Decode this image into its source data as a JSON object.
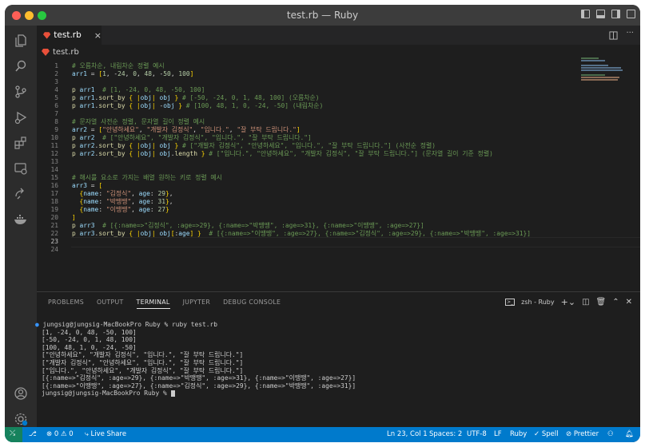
{
  "window": {
    "title": "test.rb — Ruby",
    "traffic_lights": {
      "close": "#ff5f57",
      "minimize": "#febc2e",
      "zoom": "#28c840"
    }
  },
  "tab": {
    "label": "test.rb",
    "close": "×"
  },
  "breadcrumb": {
    "file": "test.rb"
  },
  "editor": {
    "line_numbers": [
      "1",
      "2",
      "3",
      "4",
      "5",
      "6",
      "7",
      "8",
      "9",
      "10",
      "11",
      "12",
      "13",
      "14",
      "15",
      "16",
      "17",
      "18",
      "19",
      "20",
      "21",
      "22",
      "23",
      "24"
    ],
    "lines": [
      "# 오름차순, 내림차순 정렬 예시",
      "arr1 = [1, -24, 0, 48, -50, 100]",
      "",
      "p arr1  # [1, -24, 0, 48, -50, 100]",
      "p arr1.sort_by { |obj| obj } # [-50, -24, 0, 1, 48, 100] (오름차순)",
      "p arr1.sort_by { |obj| -obj } # [100, 48, 1, 0, -24, -50] (내림차순)",
      "",
      "# 문자열 사전순 정렬, 문자열 길이 정렬 예시",
      "arr2 = [\"안녕하세요\", \"개발자 김정식\", \"입니다.\", \"잘 부탁 드립니다.\"]",
      "p arr2  # [\"안녕하세요\", \"개발자 김정식\", \"입니다.\", \"잘 부탁 드립니다.\"]",
      "p arr2.sort_by { |obj| obj } # [\"개발자 김정식\", \"안녕하세요\", \"입니다.\", \"잘 부탁 드립니다.\"] (사전순 정렬)",
      "p arr2.sort_by { |obj| obj.length } # [\"입니다.\", \"안녕하세요\", \"개발자 김정식\", \"잘 부탁 드립니다.\"] (문자열 길이 기준 정렬)",
      "",
      "",
      "# 해시를 요소로 가지는 배열 원하는 키로 정렬 예시",
      "arr3 = [",
      "  {name: \"김정식\", age: 29},",
      "  {name: \"박땡땡\", age: 31},",
      "  {name: \"이땡땡\", age: 27}",
      "]",
      "p arr3  # [{:name=>\"김정식\", :age=>29}, {:name=>\"박땡땡\", :age=>31}, {:name=>\"이땡땡\", :age=>27}]",
      "p arr3.sort_by { |obj| obj[:age] }  # [{:name=>\"이땡땡\", :age=>27}, {:name=>\"김정식\", :age=>29}, {:name=>\"박땡땡\", :age=>31}]",
      "",
      ""
    ]
  },
  "panel": {
    "tabs": [
      "PROBLEMS",
      "OUTPUT",
      "TERMINAL",
      "JUPYTER",
      "DEBUG CONSOLE"
    ],
    "active_tab": "TERMINAL",
    "terminal_selector": "zsh - Ruby",
    "terminal_lines": [
      "jungsig@jungsig-MacBookPro Ruby % ruby test.rb",
      "[1, -24, 0, 48, -50, 100]",
      "[-50, -24, 0, 1, 48, 100]",
      "[100, 48, 1, 0, -24, -50]",
      "[\"안녕하세요\", \"개발자 김정식\", \"입니다.\", \"잘 부탁 드립니다.\"]",
      "[\"개발자 김정식\", \"안녕하세요\", \"입니다.\", \"잘 부탁 드립니다.\"]",
      "[\"입니다.\", \"안녕하세요\", \"개발자 김정식\", \"잘 부탁 드립니다.\"]",
      "[{:name=>\"김정식\", :age=>29}, {:name=>\"박땡땡\", :age=>31}, {:name=>\"이땡땡\", :age=>27}]",
      "[{:name=>\"이땡땡\", :age=>27}, {:name=>\"김정식\", :age=>29}, {:name=>\"박땡땡\", :age=>31}]",
      "jungsig@jungsig-MacBookPro Ruby % "
    ]
  },
  "statusbar": {
    "errors": "0",
    "warnings": "0",
    "live_share": "Live Share",
    "position": "Ln 23, Col 1",
    "spaces": "Spaces: 2",
    "encoding": "UTF-8",
    "eol": "LF",
    "language": "Ruby",
    "spell": "Spell",
    "prettier": "Prettier"
  },
  "icons": [
    "files-icon",
    "search-icon",
    "source-control-icon",
    "run-debug-icon",
    "extensions-icon",
    "remote-explorer-icon",
    "live-share-icon",
    "docker-icon",
    "account-icon",
    "settings-gear-icon"
  ],
  "colors": {
    "accent": "#007acc",
    "remote": "#16825d",
    "comment": "#6a9955",
    "string": "#ce9178",
    "variable": "#9cdcfe",
    "number": "#b5cea8"
  }
}
